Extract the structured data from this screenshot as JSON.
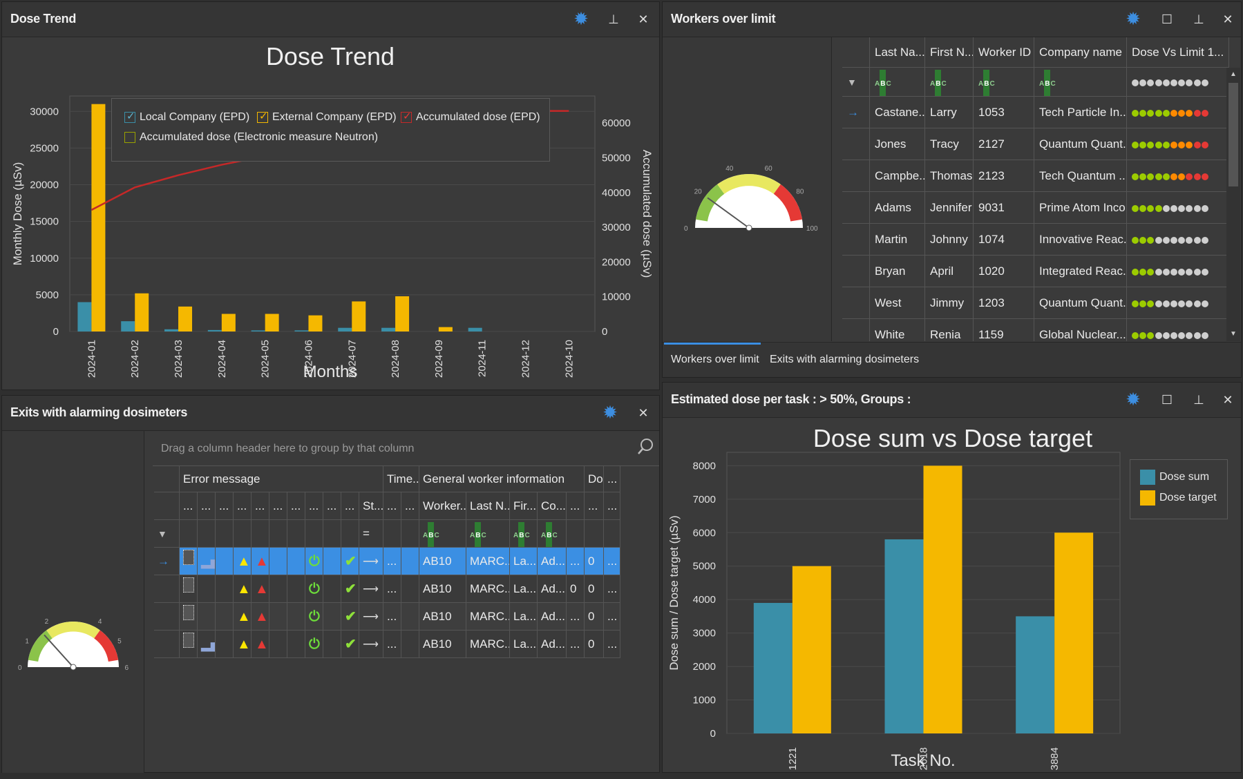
{
  "dose_trend_panel": {
    "title": "Dose Trend",
    "chart_title": "Dose Trend",
    "legend": [
      {
        "label": "Local Company (EPD)",
        "color": "#3a8fa8",
        "checked": true
      },
      {
        "label": "External Company (EPD)",
        "color": "#f5b800",
        "checked": true
      },
      {
        "label": "Accumulated dose (EPD)",
        "color": "#c62828",
        "checked": true
      },
      {
        "label": "Accumulated dose (Electronic measure Neutron)",
        "color": "#9aa300",
        "checked": false
      }
    ]
  },
  "workers_panel": {
    "title": "Workers over limit",
    "columns": [
      "Last Na...",
      "First N...",
      "Worker ID",
      "Company name",
      "Dose Vs Limit 1..."
    ],
    "filter_icon_label": "ABC",
    "rows": [
      {
        "last": "Castane...",
        "first": "Larry",
        "id": "1053",
        "company": "Tech Particle In...",
        "green": 5,
        "orange": 3,
        "red": 2
      },
      {
        "last": "Jones",
        "first": "Tracy",
        "id": "2127",
        "company": "Quantum Quant...",
        "green": 5,
        "orange": 3,
        "red": 2
      },
      {
        "last": "Campbe...",
        "first": "Thomas",
        "id": "2123",
        "company": "Tech Quantum ...",
        "green": 5,
        "orange": 2,
        "red": 3
      },
      {
        "last": "Adams",
        "first": "Jennifer",
        "id": "9031",
        "company": "Prime Atom Inco...",
        "green": 4,
        "orange": 0,
        "red": 0
      },
      {
        "last": "Martin",
        "first": "Johnny",
        "id": "1074",
        "company": "Innovative Reac...",
        "green": 3,
        "orange": 0,
        "red": 0
      },
      {
        "last": "Bryan",
        "first": "April",
        "id": "1020",
        "company": "Integrated Reac...",
        "green": 3,
        "orange": 0,
        "red": 0
      },
      {
        "last": "West",
        "first": "Jimmy",
        "id": "1203",
        "company": "Quantum Quant...",
        "green": 3,
        "orange": 0,
        "red": 0
      },
      {
        "last": "White",
        "first": "Renia",
        "id": "1159",
        "company": "Global Nuclear...",
        "green": 3,
        "orange": 0,
        "red": 0
      }
    ],
    "gauge": {
      "ticks": [
        "0",
        "20",
        "40",
        "60",
        "80",
        "100"
      ],
      "value": 20
    },
    "tabs": [
      "Workers over limit",
      "Exits with alarming dosimeters"
    ],
    "active_tab": "Workers over limit"
  },
  "exits_panel": {
    "title": "Exits with alarming dosimeters",
    "group_hint": "Drag a column header here to group by that column",
    "band_headers": [
      "Error message",
      "Time...",
      "General worker information",
      "Dos...",
      "..."
    ],
    "sub_headers": [
      "...",
      "...",
      "...",
      "...",
      "...",
      "...",
      "...",
      "...",
      "...",
      "...",
      "St...",
      "...",
      "...",
      "Worker...",
      "Last N...",
      "Fir...",
      "Co...",
      "...",
      "...",
      "..."
    ],
    "filter_eq": "=",
    "rows": [
      {
        "selected": true,
        "chart_icon": true,
        "worker": "AB10",
        "last": "MARC...",
        "first": "La...",
        "co": "Ad...",
        "d1": "...",
        "d2": "0",
        "d3": "..."
      },
      {
        "selected": false,
        "chart_icon": false,
        "worker": "AB10",
        "last": "MARC...",
        "first": "La...",
        "co": "Ad...",
        "d1": "0",
        "d2": "0",
        "d3": "..."
      },
      {
        "selected": false,
        "chart_icon": false,
        "worker": "AB10",
        "last": "MARC...",
        "first": "La...",
        "co": "Ad...",
        "d1": "...",
        "d2": "0",
        "d3": "..."
      },
      {
        "selected": false,
        "chart_icon": true,
        "worker": "AB10",
        "last": "MARC...",
        "first": "La...",
        "co": "Ad...",
        "d1": "...",
        "d2": "0",
        "d3": "..."
      }
    ],
    "gauge": {
      "ticks": [
        "0",
        "1",
        "2",
        "4",
        "5",
        "6"
      ],
      "value": 1.6
    },
    "dots": "..."
  },
  "estimated_panel": {
    "title": "Estimated dose per task : > 50%, Groups :",
    "legend": [
      {
        "label": "Dose sum",
        "color": "#3a8fa8"
      },
      {
        "label": "Dose target",
        "color": "#f5b800"
      }
    ]
  },
  "chart_data": [
    {
      "type": "bar",
      "title": "Dose Trend",
      "xlabel": "Months",
      "ylabel": "Monthly Dose (µSv)",
      "y2label": "Accumulated dose (µSv)",
      "categories": [
        "2024-01",
        "2024-02",
        "2024-03",
        "2024-04",
        "2024-05",
        "2024-06",
        "2024-07",
        "2024-08",
        "2024-09",
        "2024-11",
        "2024-12",
        "2024-10"
      ],
      "series": [
        {
          "name": "Local Company (EPD)",
          "values": [
            4000,
            1400,
            300,
            200,
            150,
            150,
            500,
            500,
            0,
            500,
            0,
            0
          ]
        },
        {
          "name": "External Company (EPD)",
          "values": [
            31000,
            5200,
            3400,
            2400,
            2400,
            2200,
            4100,
            4800,
            600,
            0,
            0,
            0
          ]
        },
        {
          "name": "Accumulated dose (EPD)",
          "type": "line",
          "axis": "y2",
          "values": [
            35000,
            41500,
            45000,
            48000,
            50500,
            53000,
            57500,
            62500,
            63000,
            63500,
            63500,
            63500
          ]
        }
      ],
      "ylim": [
        0,
        30000
      ],
      "y_ticks": [
        0,
        5000,
        10000,
        15000,
        20000,
        25000,
        30000
      ],
      "y2lim": [
        0,
        60000
      ],
      "y2_ticks": [
        0,
        10000,
        20000,
        30000,
        40000,
        50000,
        60000
      ],
      "legend_position": "top"
    },
    {
      "type": "bar",
      "title": "Dose sum vs Dose target",
      "xlabel": "Task No.",
      "ylabel": "Dose sum / Dose target (µSv)",
      "categories": [
        "1221",
        "2618",
        "3884"
      ],
      "series": [
        {
          "name": "Dose sum",
          "values": [
            3900,
            5800,
            3500
          ]
        },
        {
          "name": "Dose target",
          "values": [
            5000,
            8000,
            6000
          ]
        }
      ],
      "ylim": [
        0,
        8000
      ],
      "y_ticks": [
        0,
        1000,
        2000,
        3000,
        4000,
        5000,
        6000,
        7000,
        8000
      ],
      "legend_position": "top-right"
    }
  ]
}
